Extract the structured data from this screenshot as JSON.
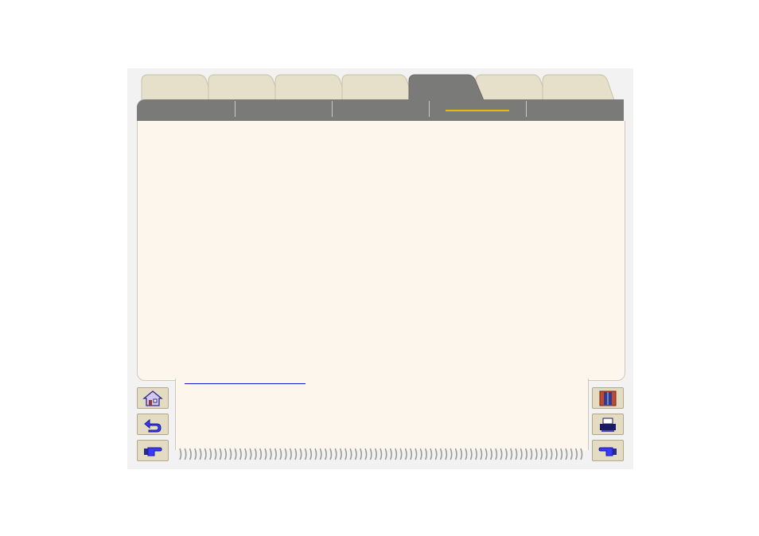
{
  "tabs": [
    {
      "id": "tab-1",
      "label": "",
      "active": false
    },
    {
      "id": "tab-2",
      "label": "",
      "active": false
    },
    {
      "id": "tab-3",
      "label": "",
      "active": false
    },
    {
      "id": "tab-4",
      "label": "",
      "active": false
    },
    {
      "id": "tab-5",
      "label": "",
      "active": true
    },
    {
      "id": "tab-6",
      "label": "",
      "active": false
    },
    {
      "id": "tab-7",
      "label": "",
      "active": false
    }
  ],
  "subnav": [
    {
      "label": "",
      "selected": false
    },
    {
      "label": "",
      "selected": false
    },
    {
      "label": "",
      "selected": false
    },
    {
      "label": "",
      "selected": true
    },
    {
      "label": "",
      "selected": false
    }
  ],
  "content": {
    "link_text": ""
  },
  "left_buttons": [
    {
      "name": "home-button",
      "icon": "home-icon"
    },
    {
      "name": "back-button",
      "icon": "back-arrow-icon"
    },
    {
      "name": "next-button",
      "icon": "pointing-hand-right-icon"
    }
  ],
  "right_buttons": [
    {
      "name": "index-button",
      "icon": "book-index-icon"
    },
    {
      "name": "print-button",
      "icon": "printer-icon"
    },
    {
      "name": "previous-button",
      "icon": "pointing-hand-left-icon"
    }
  ],
  "colors": {
    "tab_inactive": "#e6dfc9",
    "tab_active": "#7a7a78",
    "content_bg": "#fcf6ec",
    "accent_underline": "#e0c000",
    "link": "#1515cc"
  }
}
